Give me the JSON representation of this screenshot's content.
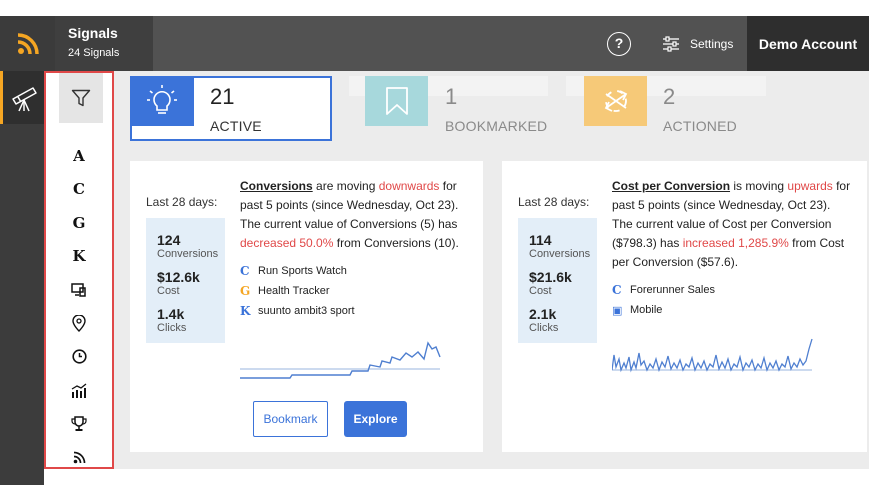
{
  "header": {
    "title": "Signals",
    "subtitle": "24 Signals",
    "help_label": "?",
    "settings_label": "Settings",
    "account_label": "Demo Account",
    "accent": "#f5a623"
  },
  "filters": [
    "A",
    "C",
    "G",
    "K"
  ],
  "stats": [
    {
      "value": "21",
      "label": "ACTIVE",
      "color": "#3b73d9"
    },
    {
      "value": "1",
      "label": "BOOKMARKED",
      "color": "#a7d8dc"
    },
    {
      "value": "2",
      "label": "ACTIONED",
      "color": "#f6c978"
    }
  ],
  "cards": [
    {
      "period": "Last 28 days:",
      "kpis": [
        {
          "value": "124",
          "label": "Conversions"
        },
        {
          "value": "$12.6k",
          "label": "Cost"
        },
        {
          "value": "1.4k",
          "label": "Clicks"
        }
      ],
      "desc": {
        "metric": "Conversions",
        "t1": " are moving ",
        "direction": "downwards",
        "t2": " for past 5 points (since Wednesday, Oct 23). The current value of Conversions (5) has ",
        "change": "decreased 50.0%",
        "t3": " from Conversions (10)."
      },
      "dimensions": [
        {
          "glyph": "C",
          "color": "#3b73d9",
          "label": "Run Sports Watch"
        },
        {
          "glyph": "G",
          "color": "#f5a623",
          "label": "Health Tracker"
        },
        {
          "glyph": "K",
          "color": "#3b73d9",
          "label": "suunto ambit3 sport"
        }
      ],
      "actions": {
        "bookmark": "Bookmark",
        "explore": "Explore"
      }
    },
    {
      "period": "Last 28 days:",
      "kpis": [
        {
          "value": "114",
          "label": "Conversions"
        },
        {
          "value": "$21.6k",
          "label": "Cost"
        },
        {
          "value": "2.1k",
          "label": "Clicks"
        }
      ],
      "desc": {
        "metric": "Cost per Conversion",
        "t1": " is moving ",
        "direction": "upwards",
        "t2": " for past 5 points (since Wednesday, Oct 23). The current value of Cost per Conversion ($798.3) has ",
        "change": "increased 1,285.9%",
        "t3": " from Cost per Conversion ($57.6)."
      },
      "dimensions": [
        {
          "glyph": "C",
          "color": "#3b73d9",
          "label": "Forerunner Sales"
        },
        {
          "glyph": "▣",
          "color": "#3b73d9",
          "label": "Mobile"
        }
      ]
    }
  ],
  "colors": {
    "primary": "#3b73d9",
    "negative": "#e04848",
    "spark": "#4f7fd0"
  }
}
